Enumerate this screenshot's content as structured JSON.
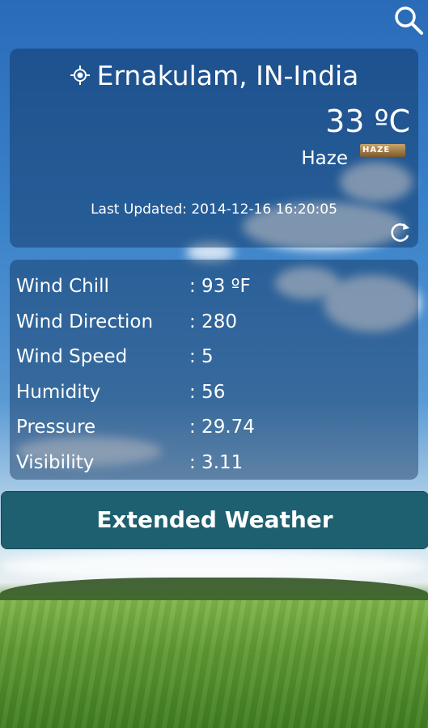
{
  "header": {
    "search_icon": "search-icon"
  },
  "current": {
    "location_icon": "location-target-icon",
    "location": "Ernakulam, IN-India",
    "temperature": "33 ºC",
    "condition": "Haze",
    "condition_badge": "HAZE",
    "last_updated": "Last Updated: 2014-12-16  16:20:05",
    "refresh_icon": "refresh-icon"
  },
  "details": [
    {
      "label": "Wind Chill",
      "value": ": 93 ºF"
    },
    {
      "label": "Wind Direction",
      "value": ": 280"
    },
    {
      "label": "Wind Speed",
      "value": ": 5"
    },
    {
      "label": "Humidity",
      "value": ": 56"
    },
    {
      "label": "Pressure",
      "value": ": 29.74"
    },
    {
      "label": "Visibility",
      "value": ": 3.11"
    }
  ],
  "actions": {
    "extended_label": "Extended Weather"
  },
  "colors": {
    "panel": "#0a2850",
    "button": "#1e5f70",
    "text": "#ffffff"
  }
}
